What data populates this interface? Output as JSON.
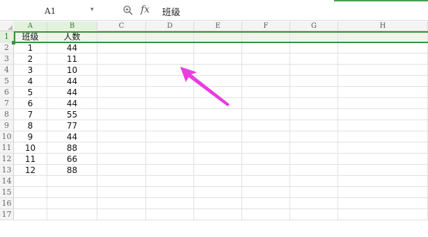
{
  "formula_bar": {
    "name_box": "A1",
    "fx_label": "fx",
    "formula_value": "班级"
  },
  "sheet": {
    "columns": [
      "A",
      "B",
      "C",
      "D",
      "E",
      "F",
      "G",
      "H"
    ],
    "row_numbers": [
      "1",
      "2",
      "3",
      "4",
      "5",
      "6",
      "7",
      "8",
      "9",
      "10",
      "11",
      "12",
      "13",
      "14",
      "15",
      "16",
      "17"
    ],
    "cells": [
      [
        "班级",
        "人数"
      ],
      [
        "1",
        "44"
      ],
      [
        "2",
        "11"
      ],
      [
        "3",
        "10"
      ],
      [
        "4",
        "44"
      ],
      [
        "5",
        "44"
      ],
      [
        "6",
        "44"
      ],
      [
        "7",
        "55"
      ],
      [
        "8",
        "77"
      ],
      [
        "9",
        "44"
      ],
      [
        "10",
        "88"
      ],
      [
        "11",
        "66"
      ],
      [
        "12",
        "88"
      ],
      [
        "",
        ""
      ],
      [
        "",
        ""
      ],
      [
        "",
        ""
      ],
      [
        "",
        ""
      ]
    ],
    "selected_row": "1",
    "selection_color": "#3b8f3b",
    "header_highlight_color": "#e3f1dd"
  },
  "annotation": {
    "type": "arrow",
    "color": "#e83de0"
  }
}
